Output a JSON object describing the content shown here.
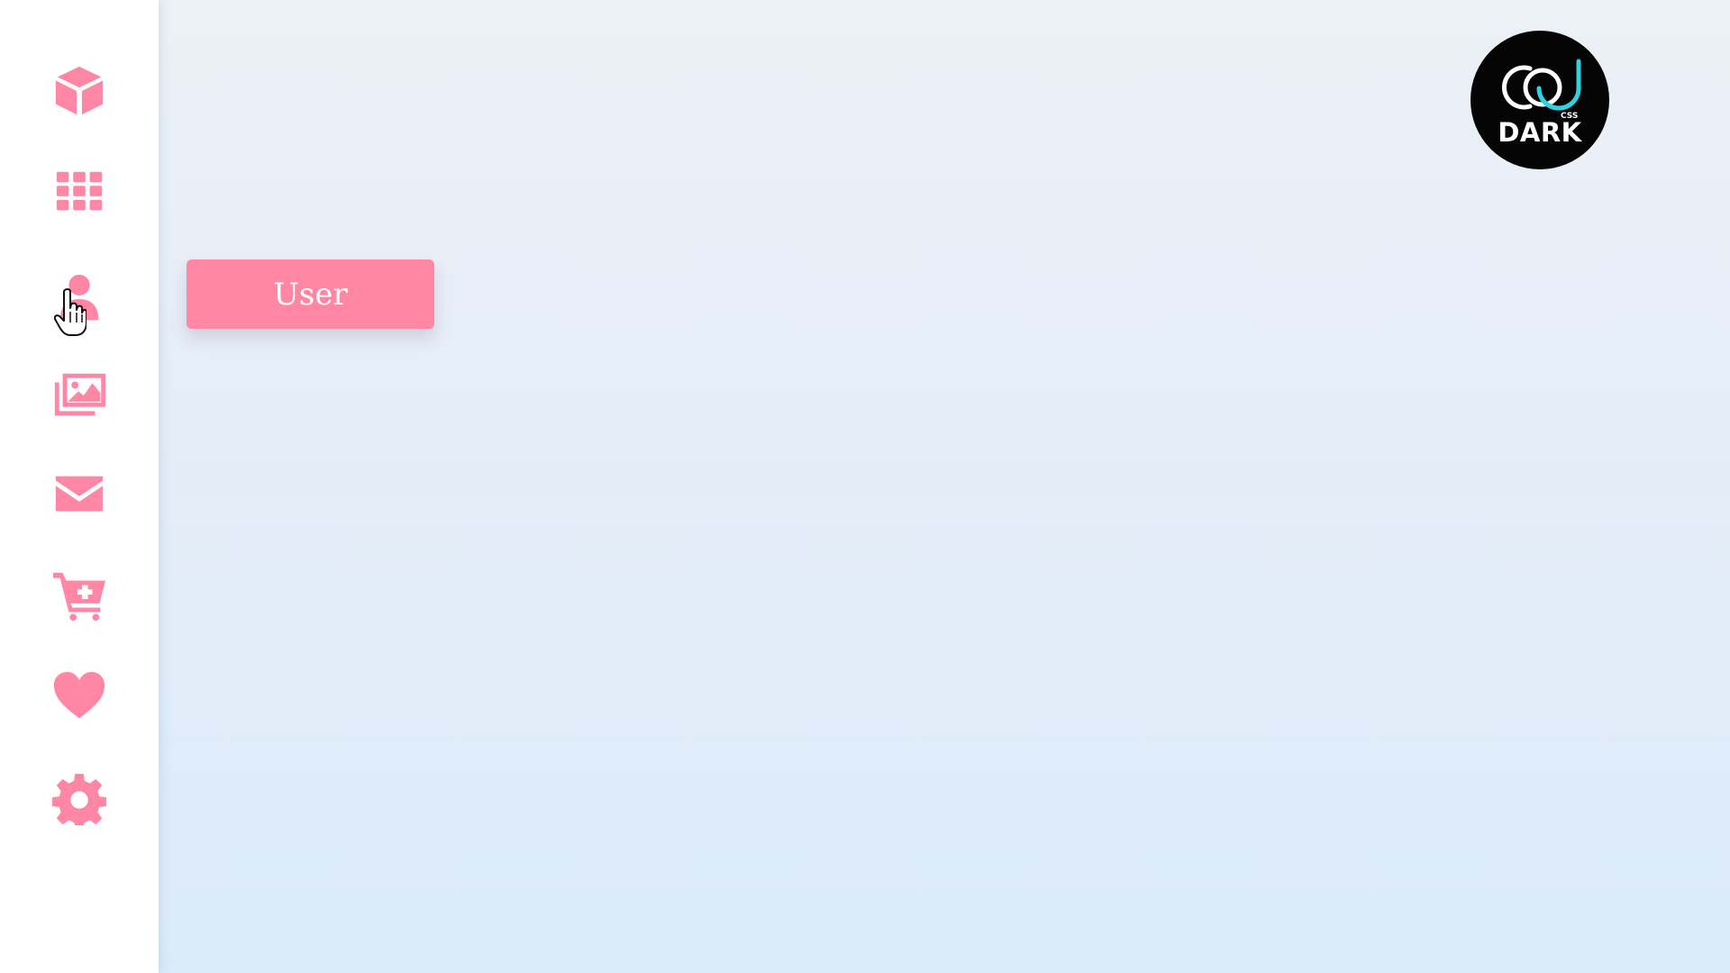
{
  "sidebar": {
    "items": [
      {
        "icon": "cube-icon"
      },
      {
        "icon": "grid-icon"
      },
      {
        "icon": "user-icon"
      },
      {
        "icon": "images-icon"
      },
      {
        "icon": "envelope-icon"
      },
      {
        "icon": "cart-plus-icon"
      },
      {
        "icon": "heart-icon"
      },
      {
        "icon": "gear-icon"
      }
    ]
  },
  "tooltip": {
    "label": "User"
  },
  "logo": {
    "small": "CSS",
    "main": "DARK"
  },
  "colors": {
    "accent": "#ff86a4",
    "sidebar": "#ffffff",
    "logo_bg": "#050505",
    "logo_ring": "#2fd3de"
  }
}
